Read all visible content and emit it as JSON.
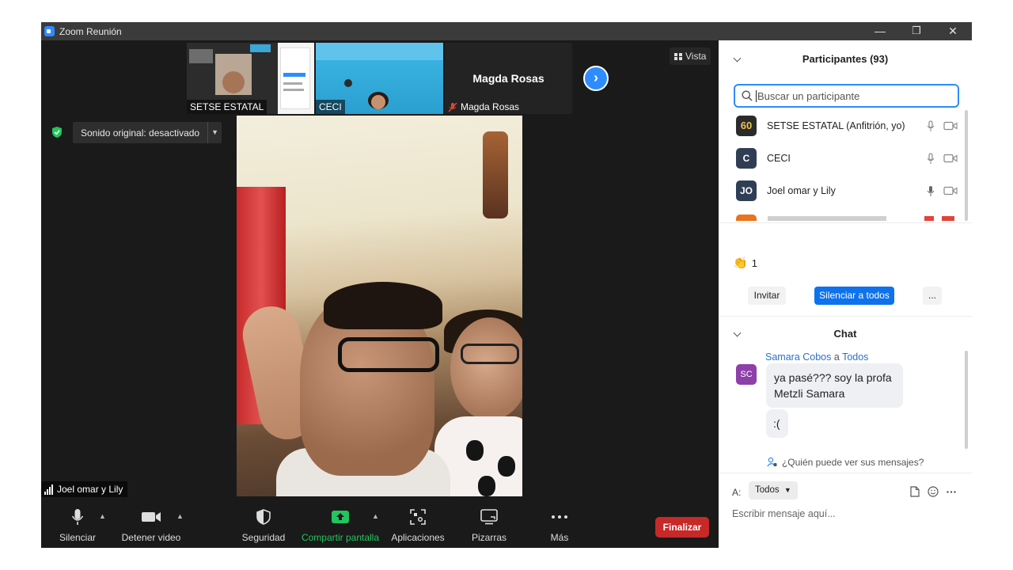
{
  "window": {
    "title": "Zoom Reunión",
    "minimize": "—",
    "restore": "❐",
    "close": "✕"
  },
  "thumbnails": [
    {
      "name": "SETSE ESTATAL"
    },
    {
      "name": "CECI"
    },
    {
      "name": "Magda Rosas",
      "big_name": "Magda Rosas"
    }
  ],
  "view_button": "Vista",
  "sound_original": "Sonido original: desactivado",
  "active_speaker": "Joel omar y Lily",
  "toolbar": {
    "mute": "Silenciar",
    "stop_video": "Detener video",
    "security": "Seguridad",
    "share_screen": "Compartir pantalla",
    "apps": "Aplicaciones",
    "whiteboards": "Pizarras",
    "more": "Más",
    "end": "Finalizar"
  },
  "participants": {
    "header": "Participantes (93)",
    "search_placeholder": "Buscar un participante",
    "list": [
      {
        "name": "SETSE ESTATAL (Anfitrión, yo)",
        "avatar": "60",
        "avatar_color": "#2b2b2b"
      },
      {
        "name": "CECI",
        "avatar": "C",
        "avatar_color": "#2f3e55"
      },
      {
        "name": "Joel omar y Lily",
        "avatar": "JO",
        "avatar_color": "#2f3e55"
      }
    ],
    "reaction_count": "1",
    "invite": "Invitar",
    "mute_all": "Silenciar a todos",
    "more": "..."
  },
  "chat": {
    "header": "Chat",
    "sender": "Samara Cobos",
    "to_word": "a",
    "recipient": "Todos",
    "sender_avatar": "SC",
    "messages": [
      "ya pasé??? soy la profa Metzli Samara",
      ":("
    ],
    "who_can_see": "¿Quién puede ver sus mensajes?",
    "to_label": "A:",
    "to_value": "Todos",
    "input_placeholder": "Escribir mensaje aquí..."
  },
  "colors": {
    "accent": "#2d8cff",
    "end_red": "#c72828",
    "share_green": "#23c55e"
  }
}
